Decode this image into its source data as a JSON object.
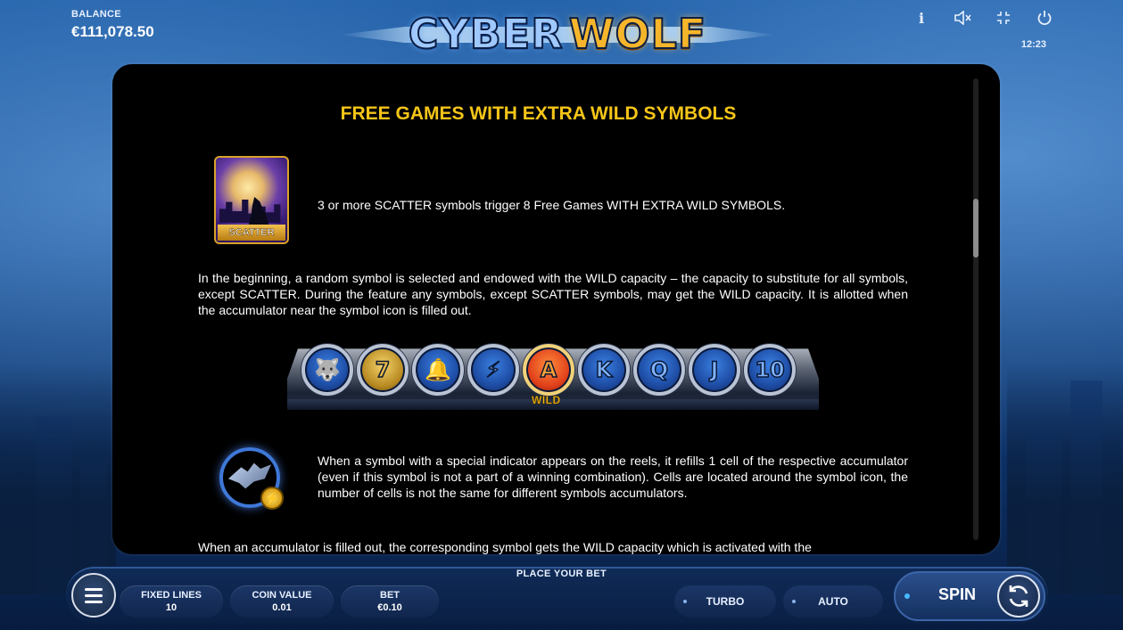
{
  "balance": {
    "label": "BALANCE",
    "value": "€111,078.50"
  },
  "logo": {
    "part1": "CYBER",
    "part2": "WOLF"
  },
  "top_icons": [
    {
      "name": "info-icon",
      "glyph": "i"
    },
    {
      "name": "sound-off-icon",
      "glyph": "◁×"
    },
    {
      "name": "fullscreen-exit-icon",
      "glyph": "⤧"
    },
    {
      "name": "power-icon",
      "glyph": "⏻"
    }
  ],
  "clock": "12:23",
  "panel": {
    "heading": "FREE GAMES WITH EXTRA WILD SYMBOLS",
    "scatter_label": "SCATTER",
    "scatter_text": "3 or more SCATTER symbols trigger 8 Free Games WITH EXTRA WILD SYMBOLS.",
    "para1": "In the beginning, a random symbol is selected and endowed with the WILD capacity – the capacity to substitute for all symbols, except SCATTER. During the feature any symbols, except SCATTER symbols, may get the WILD capacity. It is allotted when the accumulator near the symbol icon is filled out.",
    "symbols": [
      {
        "name": "wolf-symbol",
        "glyph": "🐺",
        "style": "blue"
      },
      {
        "name": "seven-symbol",
        "glyph": "7",
        "style": "gold"
      },
      {
        "name": "bell-symbol",
        "glyph": "🔔",
        "style": "blue"
      },
      {
        "name": "claw-symbol",
        "glyph": "⚡",
        "style": "blue"
      },
      {
        "name": "a-symbol",
        "glyph": "A",
        "style": "red"
      },
      {
        "name": "k-symbol",
        "glyph": "K",
        "style": "blue"
      },
      {
        "name": "q-symbol",
        "glyph": "Q",
        "style": "blue"
      },
      {
        "name": "j-symbol",
        "glyph": "J",
        "style": "blue"
      },
      {
        "name": "ten-symbol",
        "glyph": "10",
        "style": "blue"
      }
    ],
    "wild_tag": "WILD",
    "para2": "When a symbol with a special indicator appears on the reels, it refills 1 cell of the respective accumulator (even if this symbol is not a part of a winning combination). Cells are located around the symbol icon, the number of cells is not the same for different symbols accumulators.",
    "para3": "When an accumulator is filled out, the corresponding symbol gets the WILD capacity which is activated with the"
  },
  "bottom": {
    "place_bet": "PLACE YOUR BET",
    "fixed_lines": {
      "label": "FIXED LINES",
      "value": "10"
    },
    "coin_value": {
      "label": "COIN VALUE",
      "value": "0.01"
    },
    "bet": {
      "label": "BET",
      "value": "€0.10"
    },
    "turbo": "TURBO",
    "auto": "AUTO",
    "spin": "SPIN"
  },
  "colors": {
    "heading": "#f5c518",
    "panel_bg": "#000000",
    "bar_bg": "#0f2b57"
  }
}
